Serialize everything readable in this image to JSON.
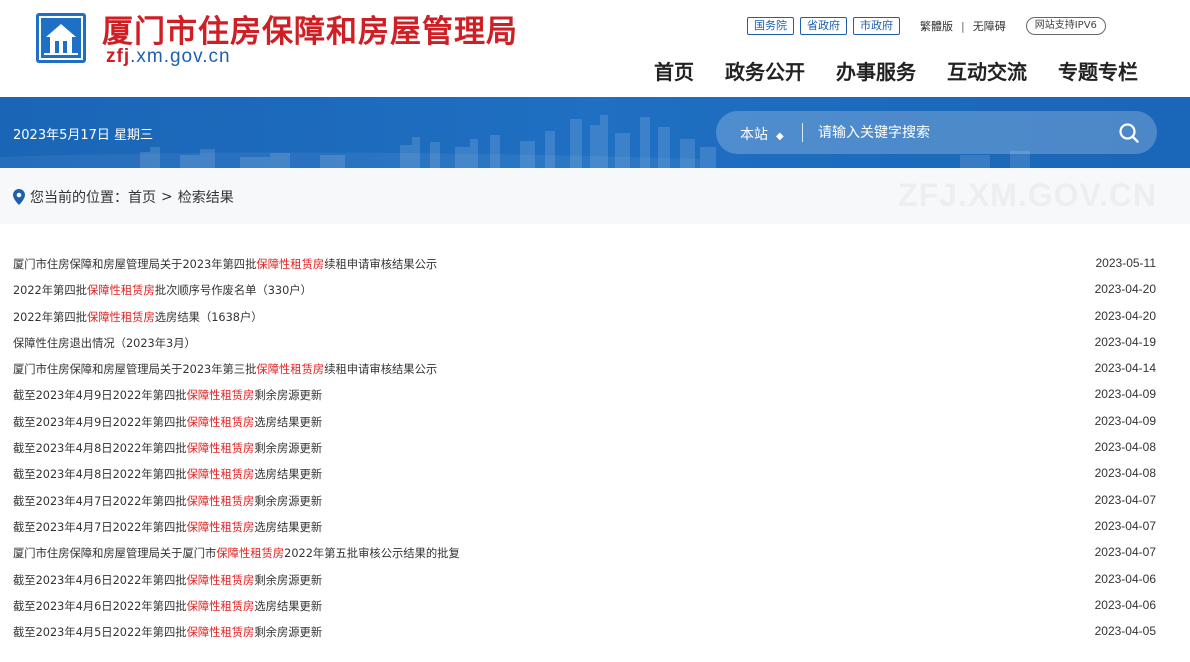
{
  "header": {
    "site_name": "厦门市住房保障和房屋管理局",
    "domain_prefix": "zfj",
    "domain_suffix": ".xm.gov.cn",
    "gov_links": [
      "国务院",
      "省政府",
      "市政府"
    ],
    "traditional_label": "繁體版",
    "accessibility_label": "无障碍",
    "ipv6_label": "网站支持IPV6",
    "nav": [
      "首页",
      "政务公开",
      "办事服务",
      "互动交流",
      "专题专栏"
    ]
  },
  "banner": {
    "date_text": "2023年5月17日 星期三",
    "search": {
      "scope_label": "本站",
      "placeholder": "请输入关键字搜索"
    }
  },
  "breadcrumb": {
    "prefix": "您当前的位置：",
    "home": "首页",
    "separator": ">",
    "current": "检索结果",
    "watermark": "ZFJ.XM.GOV.CN"
  },
  "results": [
    {
      "pre": "厦门市住房保障和房屋管理局关于2023年第四批",
      "kw": "保障性租赁房",
      "post": "续租申请审核结果公示",
      "date": "2023-05-11"
    },
    {
      "pre": "2022年第四批",
      "kw": "保障性租赁房",
      "post": "批次顺序号作废名单（330户）",
      "date": "2023-04-20"
    },
    {
      "pre": "2022年第四批",
      "kw": "保障性租赁房",
      "post": "选房结果（1638户）",
      "date": "2023-04-20"
    },
    {
      "pre": "保障性住房退出情况（2023年3月）",
      "kw": "",
      "post": "",
      "date": "2023-04-19"
    },
    {
      "pre": "厦门市住房保障和房屋管理局关于2023年第三批",
      "kw": "保障性租赁房",
      "post": "续租申请审核结果公示",
      "date": "2023-04-14"
    },
    {
      "pre": "截至2023年4月9日2022年第四批",
      "kw": "保障性租赁房",
      "post": "剩余房源更新",
      "date": "2023-04-09"
    },
    {
      "pre": "截至2023年4月9日2022年第四批",
      "kw": "保障性租赁房",
      "post": "选房结果更新",
      "date": "2023-04-09"
    },
    {
      "pre": "截至2023年4月8日2022年第四批",
      "kw": "保障性租赁房",
      "post": "剩余房源更新",
      "date": "2023-04-08"
    },
    {
      "pre": "截至2023年4月8日2022年第四批",
      "kw": "保障性租赁房",
      "post": "选房结果更新",
      "date": "2023-04-08"
    },
    {
      "pre": "截至2023年4月7日2022年第四批",
      "kw": "保障性租赁房",
      "post": "剩余房源更新",
      "date": "2023-04-07"
    },
    {
      "pre": "截至2023年4月7日2022年第四批",
      "kw": "保障性租赁房",
      "post": "选房结果更新",
      "date": "2023-04-07"
    },
    {
      "pre": "厦门市住房保障和房屋管理局关于厦门市",
      "kw": "保障性租赁房",
      "post": "2022年第五批审核公示结果的批复",
      "date": "2023-04-07"
    },
    {
      "pre": "截至2023年4月6日2022年第四批",
      "kw": "保障性租赁房",
      "post": "剩余房源更新",
      "date": "2023-04-06"
    },
    {
      "pre": "截至2023年4月6日2022年第四批",
      "kw": "保障性租赁房",
      "post": "选房结果更新",
      "date": "2023-04-06"
    },
    {
      "pre": "截至2023年4月5日2022年第四批",
      "kw": "保障性租赁房",
      "post": "剩余房源更新",
      "date": "2023-04-05"
    }
  ],
  "colors": {
    "brand_red": "#cf1f24",
    "brand_blue": "#1e6fc6",
    "keyword_red": "#e02020"
  },
  "icons": {
    "logo": "house-emblem-icon",
    "search": "search-icon",
    "location": "location-pin-icon",
    "dropdown": "updown-arrow-icon"
  }
}
